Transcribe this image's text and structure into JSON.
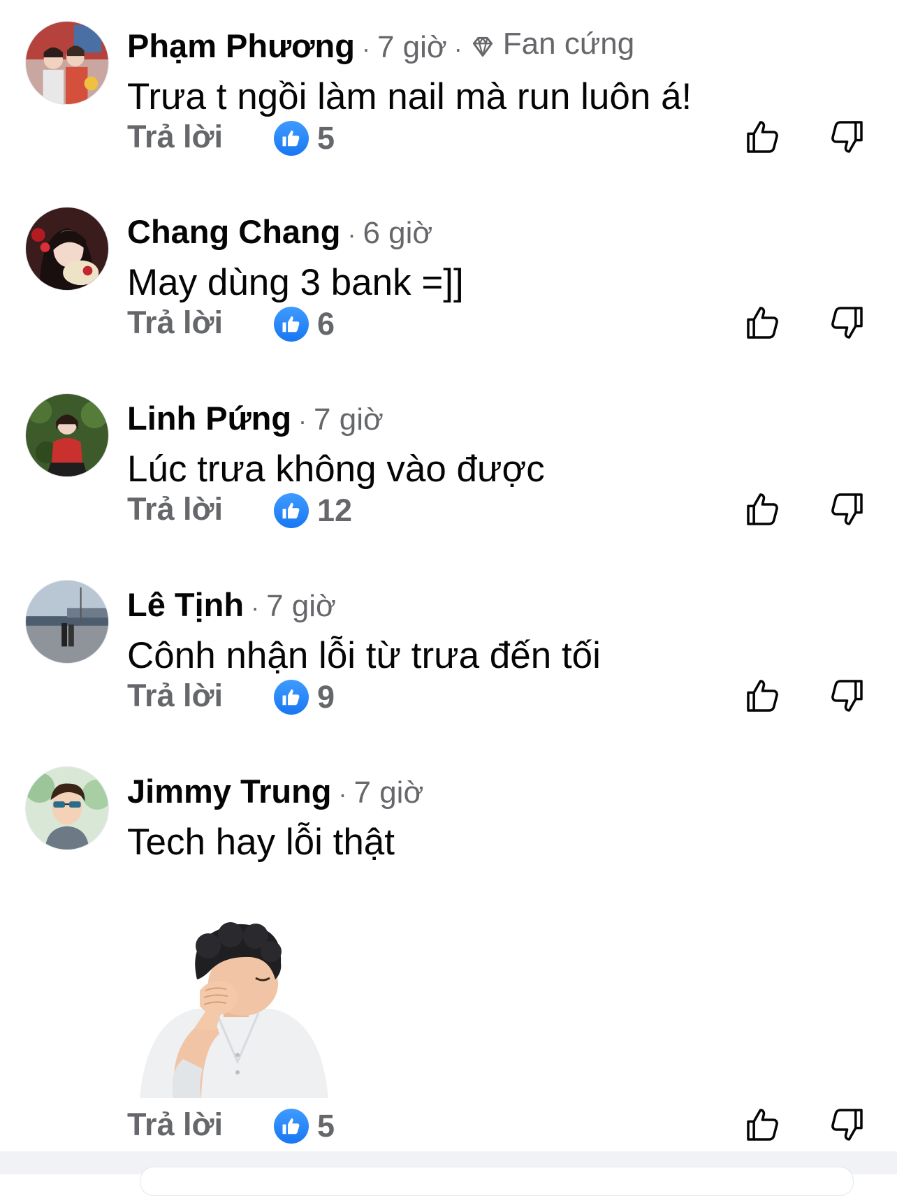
{
  "comments": [
    {
      "author": "Phạm Phương",
      "separator": "·",
      "time": "7 giờ",
      "badge": "Fan cứng",
      "badge_icon": "diamond-icon",
      "text": "Trưa t ngồi làm nail mà run luôn á!",
      "reply_label": "Trả lời",
      "like_count": "5"
    },
    {
      "author": "Chang Chang",
      "separator": "·",
      "time": "6 giờ",
      "text": "May dùng 3 bank =]]",
      "reply_label": "Trả lời",
      "like_count": "6"
    },
    {
      "author": "Linh Pứng",
      "separator": "·",
      "time": "7 giờ",
      "text": "Lúc trưa không vào được",
      "reply_label": "Trả lời",
      "like_count": "12"
    },
    {
      "author": "Lê Tịnh",
      "separator": "·",
      "time": "7 giờ",
      "text": "Cônh nhận lỗi từ trưa đến tối",
      "reply_label": "Trả lời",
      "like_count": "9"
    },
    {
      "author": "Jimmy Trung",
      "separator": "·",
      "time": "7 giờ",
      "text": "Tech hay lỗi thật",
      "sticker": "facepalm-sticker",
      "reply_label": "Trả lời",
      "like_count": "5"
    }
  ],
  "colors": {
    "text_primary": "#050505",
    "text_secondary": "#65676b",
    "like_blue": "#1877f2",
    "background": "#ffffff"
  },
  "icons": {
    "reaction": "like-reaction-icon",
    "upvote": "thumbs-up-outline-icon",
    "downvote": "thumbs-down-outline-icon"
  }
}
